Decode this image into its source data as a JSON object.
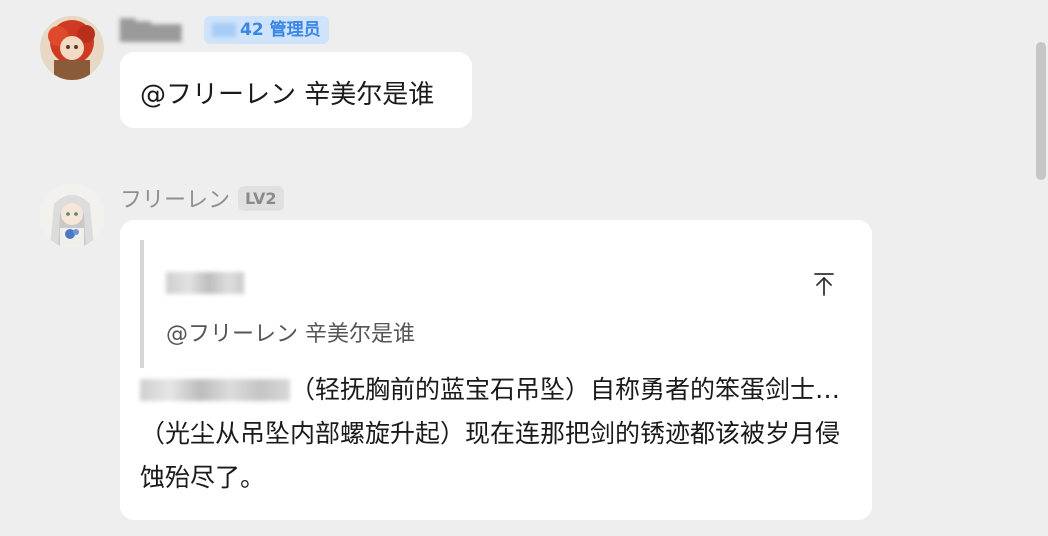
{
  "messages": [
    {
      "role": "admin",
      "sender_badge": "42 管理员",
      "text": "@フリーレン 辛美尔是谁"
    },
    {
      "sender_name": "フリーレン",
      "level_badge": "LV2",
      "quote": {
        "text": "@フリーレン 辛美尔是谁",
        "jump_icon": "arrow-up-to-top-icon"
      },
      "text": "（轻抚胸前的蓝宝石吊坠）自称勇者的笨蛋剑士…（光尘从吊坠内部螺旋升起）现在连那把剑的锈迹都该被岁月侵蚀殆尽了。"
    }
  ],
  "colors": {
    "background": "#eeeeee",
    "bubble": "#ffffff",
    "admin_badge_bg": "#cfe3fb",
    "admin_badge_text": "#3a86e6",
    "level_badge_bg": "#e0e0e0"
  }
}
